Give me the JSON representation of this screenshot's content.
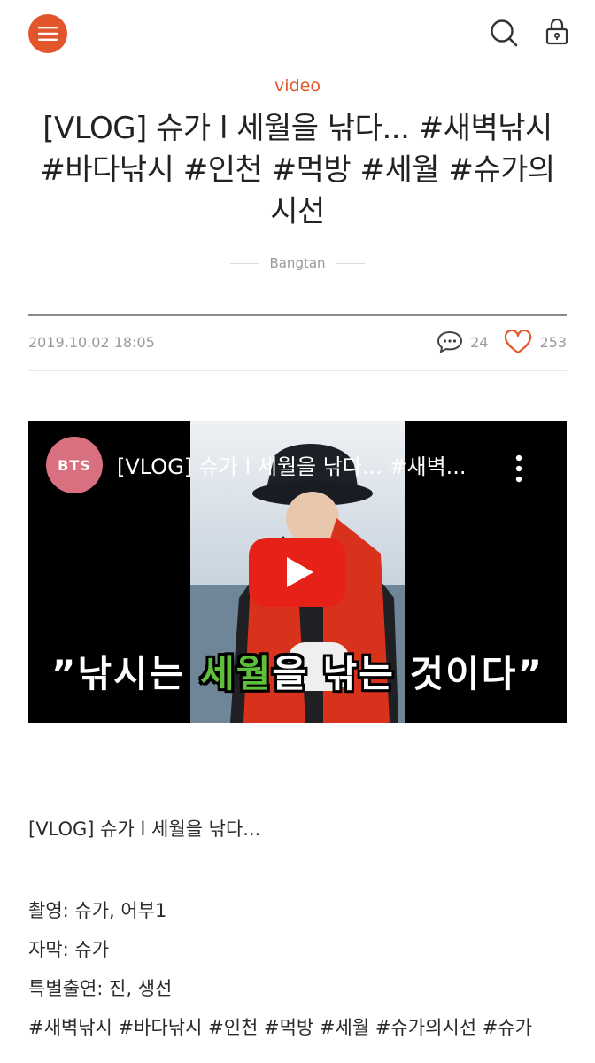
{
  "header": {
    "menu_icon": "hamburger-menu-icon",
    "search_icon": "search-icon",
    "lock_icon": "lock-icon",
    "accent": "#e3562c"
  },
  "post": {
    "category": "video",
    "title": "[VLOG] 슈가 l 세월을 낚다... #새벽낚시 #바다낚시 #인천 #먹방 #세월 #슈가의 시선",
    "author": "Bangtan",
    "date": "2019.10.02 18:05",
    "comments": "24",
    "likes": "253"
  },
  "video": {
    "channel": "BTS",
    "title": "[VLOG] 슈가 l 세월을 낚다... #새벽...",
    "caption_open": "”낚시는 ",
    "caption_highlight": "세월",
    "caption_close": "을 낚는 것이다”"
  },
  "body": {
    "title_line": "[VLOG] 슈가 l 세월을 낚다...",
    "lines": [
      "촬영: 슈가, 어부1",
      "자막: 슈가",
      "특별출연: 진, 생선",
      "#새벽낚시 #바다낚시 #인천 #먹방 #세월 #슈가의시선 #슈가"
    ]
  }
}
